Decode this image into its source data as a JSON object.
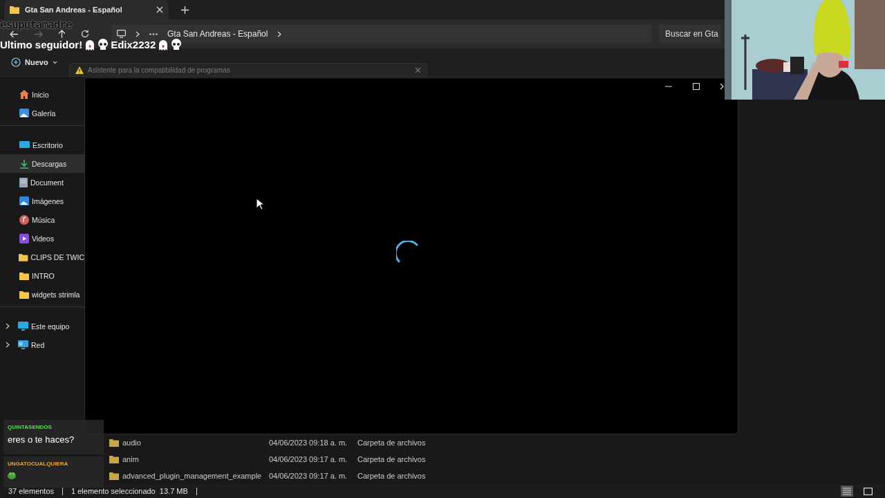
{
  "tab": {
    "title": "Gta San Andreas - Español",
    "selected": true
  },
  "address": {
    "crumbs": [
      "Gta San Andreas - Español"
    ],
    "search_placeholder": "Buscar en Gta"
  },
  "toolbar": {
    "new_label": "Nuevo"
  },
  "sidebar": {
    "sections": [
      [
        {
          "label": "Inicio",
          "kind": "home",
          "selected": false
        },
        {
          "label": "Galería",
          "kind": "gallery",
          "selected": false
        }
      ],
      [
        {
          "label": "Escritorio",
          "kind": "desktop",
          "selected": false
        },
        {
          "label": "Descargas",
          "kind": "download",
          "selected": true
        },
        {
          "label": "Document",
          "kind": "document",
          "selected": false
        },
        {
          "label": "Imágenes",
          "kind": "pictures",
          "selected": false
        },
        {
          "label": "Música",
          "kind": "music",
          "selected": false
        },
        {
          "label": "Videos",
          "kind": "video",
          "selected": false
        },
        {
          "label": "CLIPS DE TWIC",
          "kind": "folder",
          "selected": false
        },
        {
          "label": "INTRO",
          "kind": "folder",
          "selected": false
        },
        {
          "label": "widgets strimla",
          "kind": "folder",
          "selected": false
        }
      ],
      [
        {
          "label": "Este equipo",
          "kind": "pc",
          "selected": false,
          "expanded": false
        },
        {
          "label": "Red",
          "kind": "network",
          "selected": false,
          "expanded": false
        }
      ]
    ]
  },
  "files": [
    {
      "name": "audio",
      "date": "04/06/2023 09:18 a. m.",
      "type": "Carpeta de archivos"
    },
    {
      "name": "anim",
      "date": "04/06/2023 09:17 a. m.",
      "type": "Carpeta de archivos"
    },
    {
      "name": "advanced_plugin_management_example",
      "date": "04/06/2023 09:17 a. m.",
      "type": "Carpeta de archivos"
    }
  ],
  "status": {
    "count": "37 elementos",
    "selection": "1 elemento seleccionado  13.7 MB"
  },
  "view_buttons": [
    {
      "kind": "details",
      "selected": true
    },
    {
      "kind": "tiles",
      "selected": false
    }
  ],
  "dialog": {
    "title": "Asistente para la compatibilidad de programas"
  },
  "overlay": {
    "banner": "esuputamadre",
    "follower_label": "Ultimo seguidor!",
    "follower_name": "Edix2232"
  },
  "chat": [
    {
      "user": "QUINTASENDOS",
      "color": "#3de83d",
      "kind": "text",
      "message": "eres o te haces?"
    },
    {
      "user": "UNGATOCUALQUIERA",
      "color": "#e8a840",
      "kind": "emote"
    }
  ]
}
